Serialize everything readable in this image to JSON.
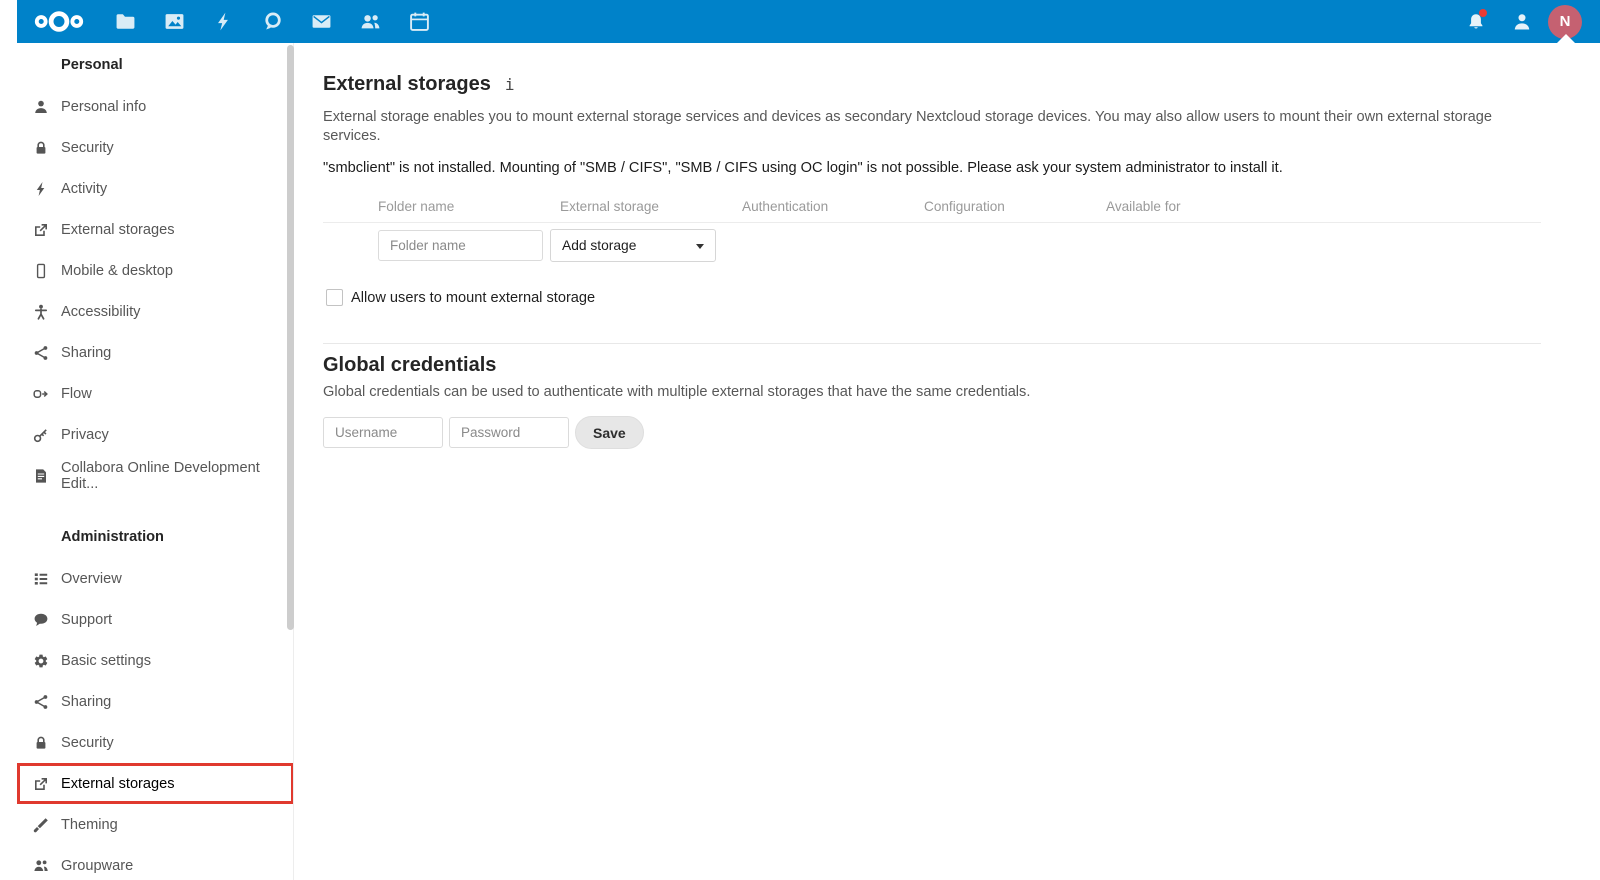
{
  "colors": {
    "header_blue": "#0082c9",
    "highlight_red": "#e0392e",
    "avatar_bg": "#c56171",
    "notification_dot": "#eb3b35"
  },
  "header": {
    "logo_icon": "nextcloud-logo",
    "apps": [
      {
        "name": "files",
        "icon": "folder"
      },
      {
        "name": "photos",
        "icon": "photos"
      },
      {
        "name": "activity",
        "icon": "bolt20"
      },
      {
        "name": "talk",
        "icon": "talk"
      },
      {
        "name": "mail",
        "icon": "mail"
      },
      {
        "name": "contacts",
        "icon": "people"
      },
      {
        "name": "calendar",
        "icon": "calendar"
      }
    ],
    "right": {
      "notifications_icon": "bell",
      "contacts_menu_icon": "user",
      "avatar_initial": "N"
    }
  },
  "sidebar": {
    "sections": [
      {
        "title": "Personal",
        "items": [
          {
            "label": "Personal info",
            "icon": "user"
          },
          {
            "label": "Security",
            "icon": "lock"
          },
          {
            "label": "Activity",
            "icon": "bolt"
          },
          {
            "label": "External storages",
            "icon": "external"
          },
          {
            "label": "Mobile & desktop",
            "icon": "phone"
          },
          {
            "label": "Accessibility",
            "icon": "accessibility"
          },
          {
            "label": "Sharing",
            "icon": "share"
          },
          {
            "label": "Flow",
            "icon": "flow"
          },
          {
            "label": "Privacy",
            "icon": "key"
          },
          {
            "label": "Collabora Online Development Edit...",
            "icon": "document"
          }
        ]
      },
      {
        "title": "Administration",
        "items": [
          {
            "label": "Overview",
            "icon": "list"
          },
          {
            "label": "Support",
            "icon": "chat"
          },
          {
            "label": "Basic settings",
            "icon": "gear"
          },
          {
            "label": "Sharing",
            "icon": "share"
          },
          {
            "label": "Security",
            "icon": "lock"
          },
          {
            "label": "External storages",
            "icon": "external",
            "active": true
          },
          {
            "label": "Theming",
            "icon": "brush"
          },
          {
            "label": "Groupware",
            "icon": "group"
          }
        ]
      }
    ]
  },
  "main": {
    "title": "External storages",
    "info_icon": "i",
    "description": "External storage enables you to mount external storage services and devices as secondary Nextcloud storage devices. You may also allow users to mount their own external storage services.",
    "warning": "\"smbclient\" is not installed. Mounting of \"SMB / CIFS\", \"SMB / CIFS using OC login\" is not possible. Please ask your system administrator to install it.",
    "table_headers": [
      "Folder name",
      "External storage",
      "Authentication",
      "Configuration",
      "Available for"
    ],
    "folder_name_placeholder": "Folder name",
    "add_storage_label": "Add storage",
    "allow_users_label": "Allow users to mount external storage",
    "global_credentials": {
      "title": "Global credentials",
      "description": "Global credentials can be used to authenticate with multiple external storages that have the same credentials.",
      "username_placeholder": "Username",
      "password_placeholder": "Password",
      "save_label": "Save"
    }
  }
}
